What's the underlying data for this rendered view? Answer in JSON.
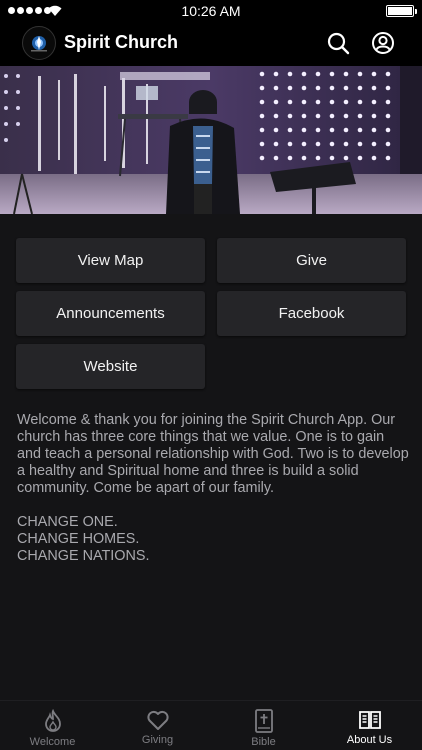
{
  "status_bar": {
    "time": "10:26 AM",
    "battery_level": 1.0
  },
  "header": {
    "title": "Spirit Church",
    "icons": [
      "search-icon",
      "profile-icon"
    ]
  },
  "actions": {
    "view_map": "View Map",
    "give": "Give",
    "announcements": "Announcements",
    "facebook": "Facebook",
    "website": "Website"
  },
  "about": {
    "paragraph": "Welcome & thank you for joining the Spirit Church App. Our church has three core things that we value. One is to gain and teach a personal relationship with God. Two is to develop a healthy and Spiritual home and three is build a solid community. Come be apart of our family.",
    "lines": [
      "CHANGE ONE.",
      "CHANGE HOMES.",
      "CHANGE NATIONS."
    ]
  },
  "tabs": [
    {
      "label": "Welcome",
      "icon": "flame-icon",
      "active": false
    },
    {
      "label": "Giving",
      "icon": "heart-icon",
      "active": false
    },
    {
      "label": "Bible",
      "icon": "bible-icon",
      "active": false
    },
    {
      "label": "About Us",
      "icon": "book-open-icon",
      "active": true
    }
  ],
  "colors": {
    "background": "#141416",
    "button": "#252528",
    "text_muted": "#a9a9ae",
    "tab_inactive": "#7d7d82"
  }
}
